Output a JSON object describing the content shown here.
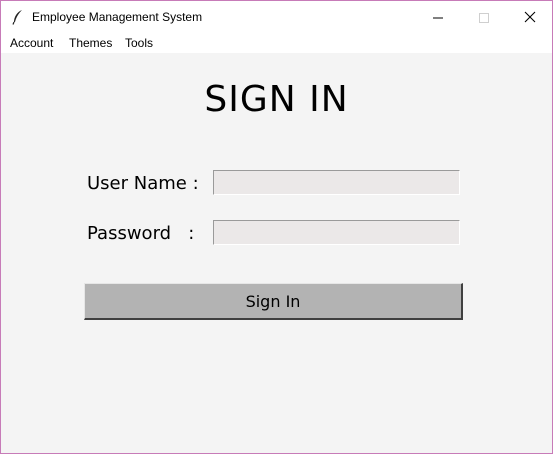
{
  "window": {
    "title": "Employee Management System",
    "icon": "feather-icon"
  },
  "menubar": {
    "items": [
      "Account",
      "Themes",
      "Tools"
    ]
  },
  "form": {
    "heading": "SIGN IN",
    "username_label": "User Name :",
    "username_value": "",
    "password_label": "Password   :",
    "password_value": "",
    "submit_label": "Sign In"
  }
}
